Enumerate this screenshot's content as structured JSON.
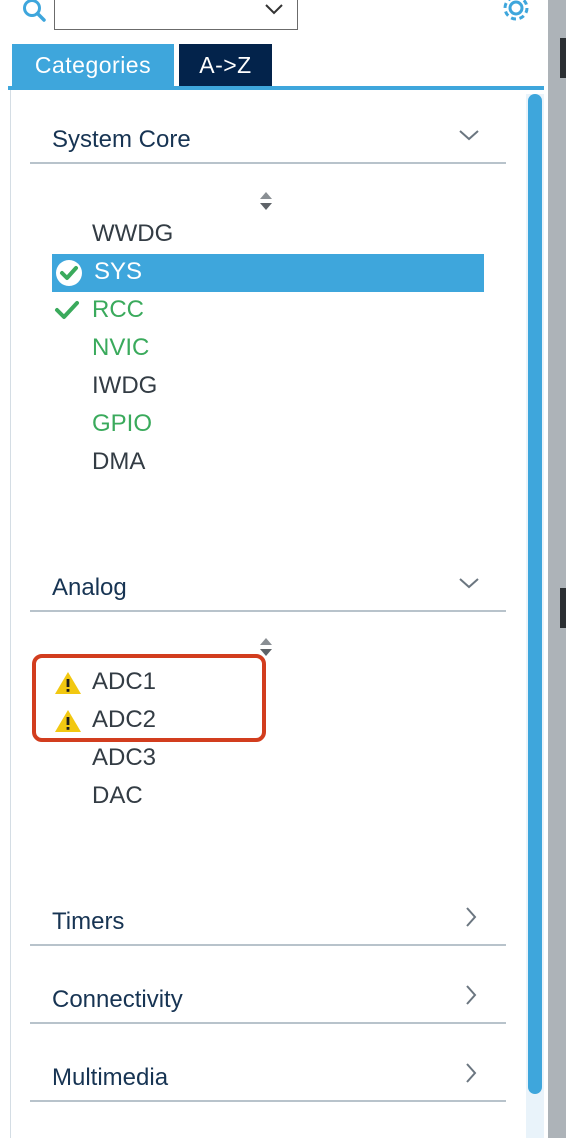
{
  "search": {
    "value": ""
  },
  "tabs": [
    {
      "label": "Categories",
      "active": true
    },
    {
      "label": "A->Z",
      "active": false
    }
  ],
  "sections": {
    "system_core": {
      "title": "System Core",
      "items": [
        {
          "label": "WWDG",
          "status": "none"
        },
        {
          "label": "SYS",
          "status": "ok-selected"
        },
        {
          "label": "RCC",
          "status": "ok"
        },
        {
          "label": "NVIC",
          "status": "configured"
        },
        {
          "label": "IWDG",
          "status": "none"
        },
        {
          "label": "GPIO",
          "status": "configured"
        },
        {
          "label": "DMA",
          "status": "none"
        }
      ]
    },
    "analog": {
      "title": "Analog",
      "items": [
        {
          "label": "ADC1",
          "status": "warning"
        },
        {
          "label": "ADC2",
          "status": "warning"
        },
        {
          "label": "ADC3",
          "status": "none"
        },
        {
          "label": "DAC",
          "status": "none"
        }
      ]
    },
    "timers": {
      "title": "Timers"
    },
    "connectivity": {
      "title": "Connectivity"
    },
    "multimedia": {
      "title": "Multimedia"
    }
  },
  "colors": {
    "accent": "#3ea6dc",
    "tab_dark": "#03234b",
    "ok_green": "#3aaa5c",
    "warning_yellow": "#f2c811",
    "highlight_red": "#d23d1e"
  },
  "icons": [
    "search-icon",
    "chevron-down-icon",
    "gear-icon",
    "sort-icon",
    "check-circle-icon",
    "check-icon",
    "warning-icon",
    "chevron-right-icon"
  ]
}
